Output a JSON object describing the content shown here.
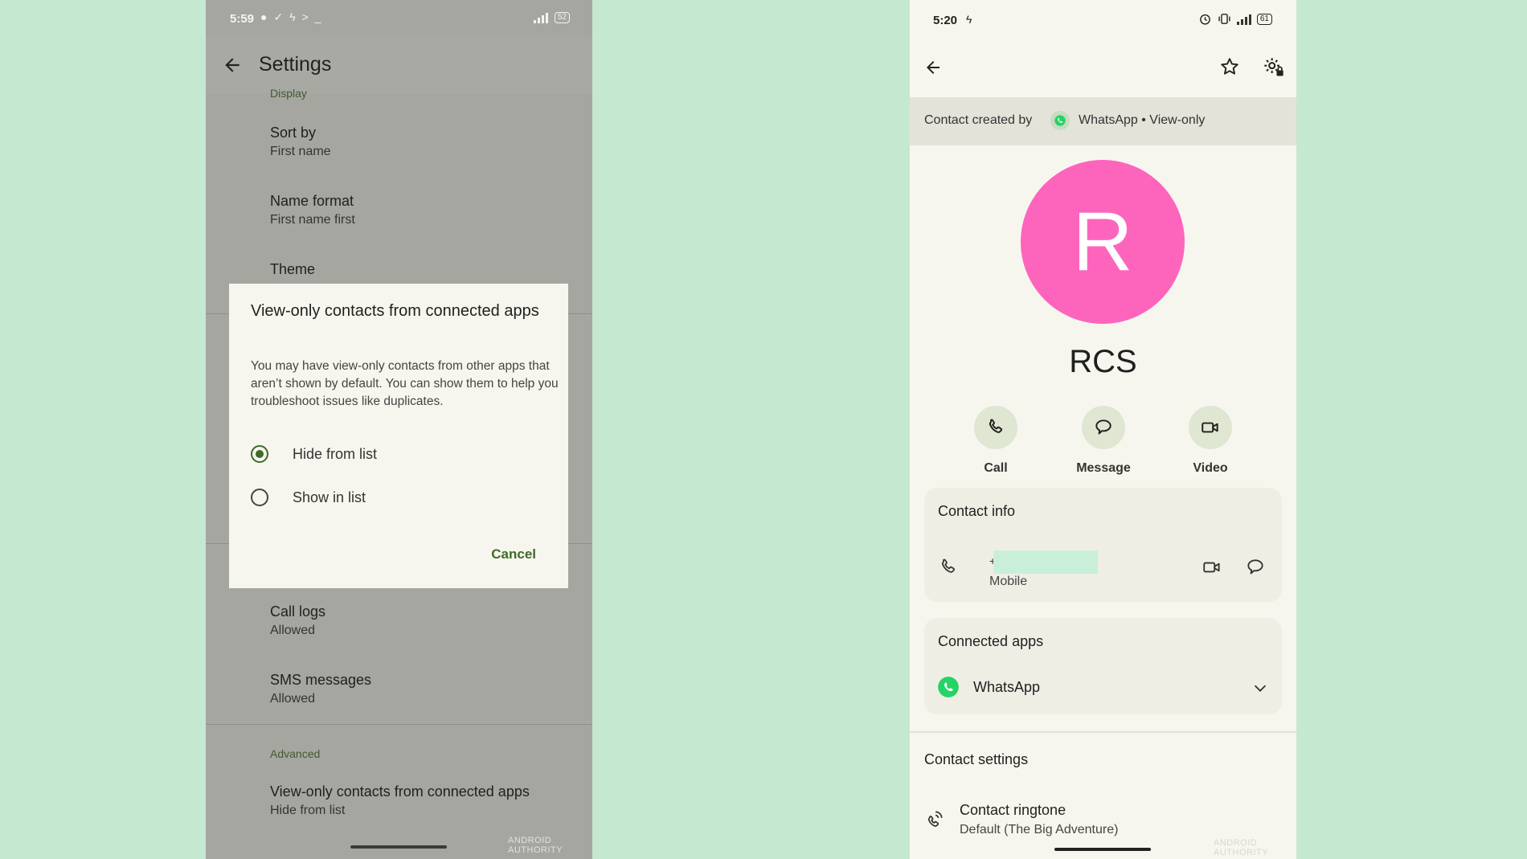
{
  "left_phone": {
    "status": {
      "time": "5:59",
      "battery": "52",
      "icons": [
        "chat-bubble-icon",
        "check-icon",
        "bolt-icon",
        "terminal-icon"
      ]
    },
    "appbar": {
      "title": "Settings"
    },
    "sections": {
      "display": "Display",
      "advanced": "Advanced"
    },
    "items": [
      {
        "title": "Sort by",
        "subtitle": "First name"
      },
      {
        "title": "Name format",
        "subtitle": "First name first"
      },
      {
        "title": "Theme",
        "subtitle": ""
      },
      {
        "title": "Call logs",
        "subtitle": "Allowed"
      },
      {
        "title": "SMS messages",
        "subtitle": "Allowed"
      },
      {
        "title": "View-only contacts from connected apps",
        "subtitle": "Hide from list"
      }
    ],
    "dialog": {
      "title": "View-only contacts from connected apps",
      "body": "You may have view-only contacts from other apps that aren’t shown by default. You can show them to help you troubleshoot issues like duplicates.",
      "options": [
        {
          "label": "Hide from list",
          "selected": true
        },
        {
          "label": "Show in list",
          "selected": false
        }
      ],
      "cancel": "Cancel"
    },
    "watermark": "ANDROID AUTHORITY"
  },
  "right_phone": {
    "status": {
      "time": "5:20",
      "battery": "61"
    },
    "banner": {
      "prefix": "Contact created by",
      "app": "WhatsApp • View-only"
    },
    "avatar_letter": "R",
    "avatar_color": "#fd65bd",
    "contact_name": "RCS",
    "actions": [
      {
        "label": "Call",
        "icon": "phone-icon"
      },
      {
        "label": "Message",
        "icon": "message-icon"
      },
      {
        "label": "Video",
        "icon": "video-icon"
      }
    ],
    "contact_info": {
      "title": "Contact info",
      "number": "+",
      "type": "Mobile"
    },
    "connected_apps": {
      "title": "Connected apps",
      "app": "WhatsApp"
    },
    "contact_settings": {
      "title": "Contact settings",
      "ringtone_title": "Contact ringtone",
      "ringtone_value": "Default (The Big Adventure)"
    },
    "watermark": "ANDROID AUTHORITY"
  },
  "colors": {
    "background": "#c5e8d0",
    "accent_green": "#3e6a2a",
    "whatsapp_green": "#25d366"
  }
}
